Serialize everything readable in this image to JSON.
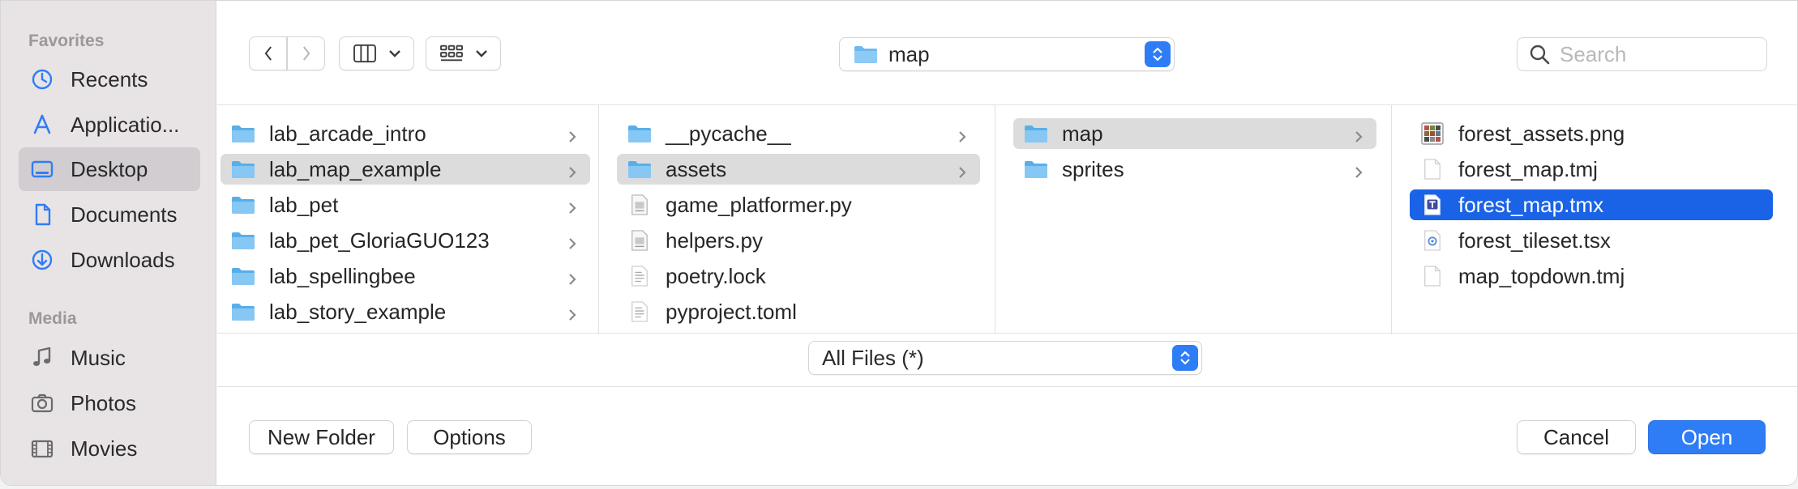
{
  "sidebar": {
    "favorites_heading": "Favorites",
    "media_heading": "Media",
    "favorites": [
      {
        "label": "Recents",
        "icon": "clock-icon",
        "active": false
      },
      {
        "label": "Applicatio...",
        "icon": "applications-icon",
        "active": false
      },
      {
        "label": "Desktop",
        "icon": "desktop-icon",
        "active": true
      },
      {
        "label": "Documents",
        "icon": "document-icon",
        "active": false
      },
      {
        "label": "Downloads",
        "icon": "download-icon",
        "active": false
      }
    ],
    "media": [
      {
        "label": "Music",
        "icon": "music-note-icon"
      },
      {
        "label": "Photos",
        "icon": "camera-icon"
      },
      {
        "label": "Movies",
        "icon": "film-icon"
      }
    ]
  },
  "toolbar": {
    "location": "map",
    "search_placeholder": "Search"
  },
  "columns": [
    {
      "items": [
        {
          "label": "lab_arcade_intro",
          "type": "folder",
          "state": "none"
        },
        {
          "label": "lab_map_example",
          "type": "folder",
          "state": "path"
        },
        {
          "label": "lab_pet",
          "type": "folder",
          "state": "none"
        },
        {
          "label": "lab_pet_GloriaGUO123",
          "type": "folder",
          "state": "none"
        },
        {
          "label": "lab_spellingbee",
          "type": "folder",
          "state": "none"
        },
        {
          "label": "lab_story_example",
          "type": "folder",
          "state": "none"
        }
      ]
    },
    {
      "items": [
        {
          "label": "__pycache__",
          "type": "folder",
          "state": "none"
        },
        {
          "label": "assets",
          "type": "folder",
          "state": "path"
        },
        {
          "label": "game_platformer.py",
          "type": "python",
          "state": "none"
        },
        {
          "label": "helpers.py",
          "type": "python",
          "state": "none"
        },
        {
          "label": "poetry.lock",
          "type": "text",
          "state": "none"
        },
        {
          "label": "pyproject.toml",
          "type": "text",
          "state": "none"
        }
      ]
    },
    {
      "items": [
        {
          "label": "map",
          "type": "folder",
          "state": "path"
        },
        {
          "label": "sprites",
          "type": "folder",
          "state": "none"
        }
      ]
    },
    {
      "items": [
        {
          "label": "forest_assets.png",
          "type": "image",
          "state": "none"
        },
        {
          "label": "forest_map.tmj",
          "type": "blank",
          "state": "none"
        },
        {
          "label": "forest_map.tmx",
          "type": "tmx",
          "state": "selected"
        },
        {
          "label": "forest_tileset.tsx",
          "type": "tsx",
          "state": "none"
        },
        {
          "label": "map_topdown.tmj",
          "type": "blank",
          "state": "none"
        }
      ]
    }
  ],
  "format": {
    "selected": "All Files (*)"
  },
  "buttons": {
    "new_folder": "New Folder",
    "options": "Options",
    "cancel": "Cancel",
    "open": "Open"
  },
  "colors": {
    "accent": "#2f7df6",
    "selection": "#1b63e6",
    "folder": "#6cb8ef"
  }
}
